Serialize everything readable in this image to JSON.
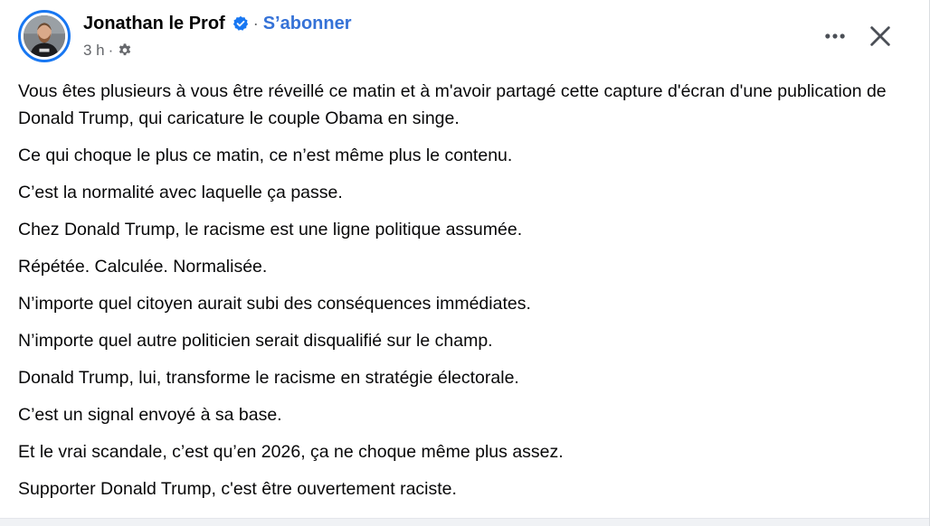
{
  "post": {
    "author": {
      "name": "Jonathan le Prof",
      "verified": true,
      "avatar_icon": "profile-photo"
    },
    "separator": "·",
    "follow_label": "S’abonner",
    "time": "3 h",
    "time_separator": "·",
    "privacy_icon": "gear-icon",
    "more_icon": "more-horizontal-icon",
    "close_icon": "close-icon",
    "paragraphs": [
      "Vous êtes plusieurs à vous être réveillé ce matin et à m'avoir partagé cette capture d'écran d'une publication de Donald Trump, qui caricature le couple Obama en singe.",
      "Ce qui choque le plus ce matin, ce n’est même plus le contenu.",
      "C’est la normalité avec laquelle ça passe.",
      "Chez Donald Trump, le racisme est une ligne politique assumée.",
      "Répétée. Calculée. Normalisée.",
      "N’importe quel citoyen aurait subi des conséquences immédiates.",
      "N’importe quel autre politicien serait disqualifié sur le champ.",
      "Donald Trump, lui, transforme le racisme en stratégie électorale.",
      "C’est un signal envoyé à sa base.",
      "Et le vrai scandale, c’est qu’en 2026, ça ne choque même plus assez.",
      "Supporter Donald Trump, c'est être ouvertement raciste."
    ]
  },
  "colors": {
    "accent": "#1877f2",
    "link": "#3572d7",
    "secondary_text": "#65676b",
    "primary_text": "#080809"
  }
}
